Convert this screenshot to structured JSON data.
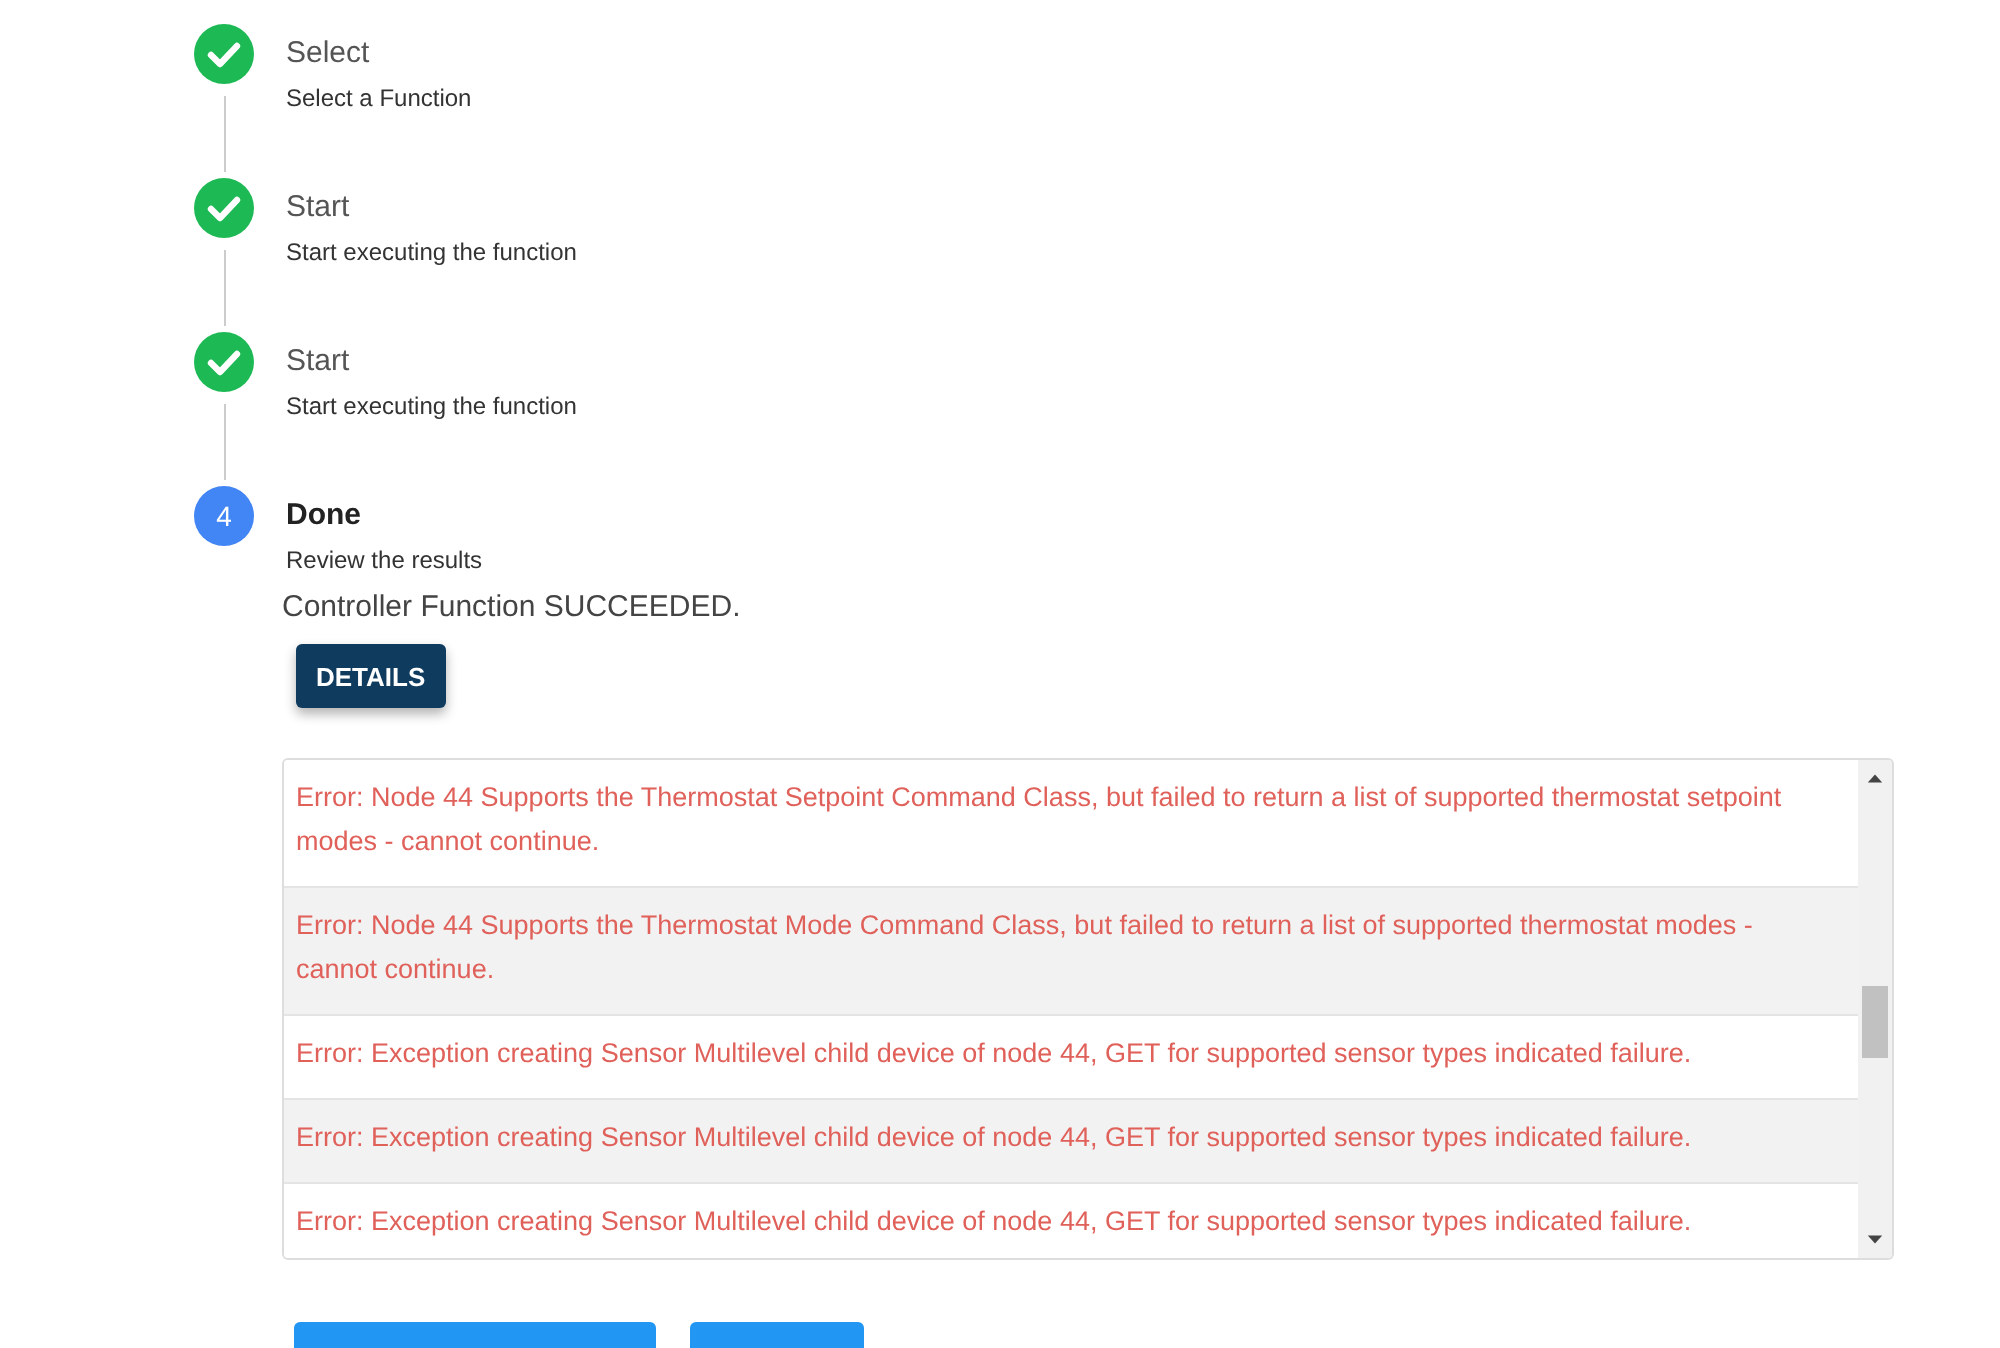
{
  "steps": [
    {
      "title": "Select",
      "subtitle": "Select a Function",
      "completed": true
    },
    {
      "title": "Start",
      "subtitle": "Start executing the function",
      "completed": true
    },
    {
      "title": "Start",
      "subtitle": "Start executing the function",
      "completed": true
    },
    {
      "title": "Done",
      "subtitle": "Review the results",
      "completed": false,
      "number": "4"
    }
  ],
  "result": "Controller Function SUCCEEDED.",
  "details_button": "DETAILS",
  "log": [
    "Error: Node 44 Supports the Thermostat Setpoint Command Class, but failed to return a list of supported thermostat setpoint modes - cannot continue.",
    "Error: Node 44 Supports the Thermostat Mode Command Class, but failed to return a list of supported thermostat modes - cannot continue.",
    "Error: Exception creating Sensor Multilevel child device of node 44, GET for supported sensor types indicated failure.",
    "Error: Exception creating Sensor Multilevel child device of node 44, GET for supported sensor types indicated failure.",
    "Error: Exception creating Sensor Multilevel child device of node 44, GET for supported sensor types indicated failure."
  ]
}
